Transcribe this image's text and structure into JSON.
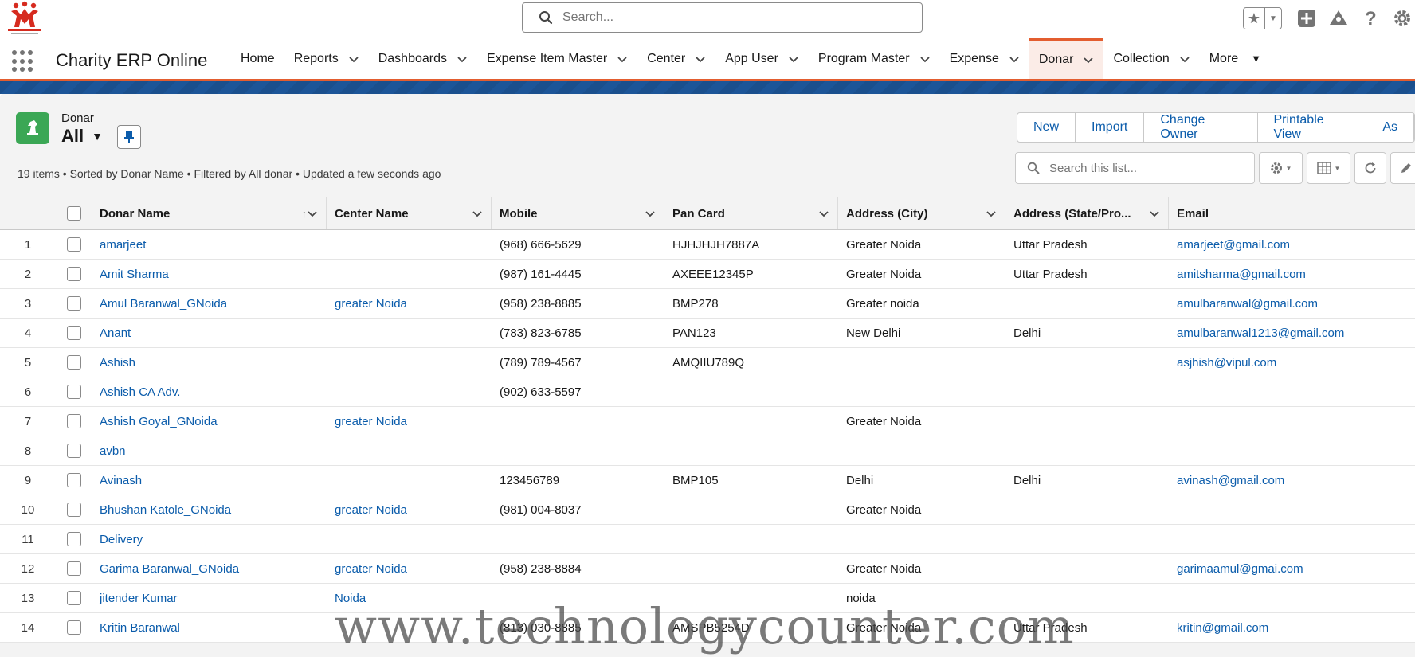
{
  "header": {
    "search_placeholder": "Search..."
  },
  "app": {
    "name": "Charity ERP Online"
  },
  "nav": [
    {
      "label": "Home",
      "has_menu": false
    },
    {
      "label": "Reports",
      "has_menu": true
    },
    {
      "label": "Dashboards",
      "has_menu": true
    },
    {
      "label": "Expense Item Master",
      "has_menu": true
    },
    {
      "label": "Center",
      "has_menu": true
    },
    {
      "label": "App User",
      "has_menu": true
    },
    {
      "label": "Program Master",
      "has_menu": true
    },
    {
      "label": "Expense",
      "has_menu": true
    },
    {
      "label": "Donar",
      "has_menu": true,
      "active": true
    },
    {
      "label": "Collection",
      "has_menu": true
    },
    {
      "label": "More",
      "has_menu": true,
      "more": true
    }
  ],
  "list": {
    "object_label": "Donar",
    "view_name": "All",
    "info": "19 items • Sorted by Donar Name • Filtered by All donar • Updated a few seconds ago",
    "actions": [
      "New",
      "Import",
      "Change Owner",
      "Printable View",
      "As"
    ],
    "search_placeholder": "Search this list..."
  },
  "table": {
    "columns": [
      "Donar Name",
      "Center Name",
      "Mobile",
      "Pan Card",
      "Address (City)",
      "Address (State/Pro...",
      "Email"
    ],
    "rows": [
      {
        "n": "1",
        "name": "amarjeet",
        "center": "",
        "mobile": "(968) 666-5629",
        "pan": "HJHJHJH7887A",
        "city": "Greater Noida",
        "state": "Uttar Pradesh",
        "email": "amarjeet@gmail.com"
      },
      {
        "n": "2",
        "name": "Amit Sharma",
        "center": "",
        "mobile": "(987) 161-4445",
        "pan": "AXEEE12345P",
        "city": "Greater Noida",
        "state": "Uttar Pradesh",
        "email": "amitsharma@gmail.com"
      },
      {
        "n": "3",
        "name": "Amul Baranwal_GNoida",
        "center": "greater Noida",
        "mobile": "(958) 238-8885",
        "pan": "BMP278",
        "city": "Greater noida",
        "state": "",
        "email": "amulbaranwal@gmail.com"
      },
      {
        "n": "4",
        "name": "Anant",
        "center": "",
        "mobile": "(783) 823-6785",
        "pan": "PAN123",
        "city": "New Delhi",
        "state": "Delhi",
        "email": "amulbaranwal1213@gmail.com"
      },
      {
        "n": "5",
        "name": "Ashish",
        "center": "",
        "mobile": "(789) 789-4567",
        "pan": "AMQIIU789Q",
        "city": "",
        "state": "",
        "email": "asjhish@vipul.com"
      },
      {
        "n": "6",
        "name": "Ashish CA Adv.",
        "center": "",
        "mobile": "(902) 633-5597",
        "pan": "",
        "city": "",
        "state": "",
        "email": ""
      },
      {
        "n": "7",
        "name": "Ashish Goyal_GNoida",
        "center": "greater Noida",
        "mobile": "",
        "pan": "",
        "city": "Greater Noida",
        "state": "",
        "email": ""
      },
      {
        "n": "8",
        "name": "avbn",
        "center": "",
        "mobile": "",
        "pan": "",
        "city": "",
        "state": "",
        "email": ""
      },
      {
        "n": "9",
        "name": "Avinash",
        "center": "",
        "mobile": "123456789",
        "pan": "BMP105",
        "city": "Delhi",
        "state": "Delhi",
        "email": "avinash@gmail.com"
      },
      {
        "n": "10",
        "name": "Bhushan Katole_GNoida",
        "center": "greater Noida",
        "mobile": "(981) 004-8037",
        "pan": "",
        "city": "Greater Noida",
        "state": "",
        "email": ""
      },
      {
        "n": "11",
        "name": "Delivery",
        "center": "",
        "mobile": "",
        "pan": "",
        "city": "",
        "state": "",
        "email": ""
      },
      {
        "n": "12",
        "name": "Garima Baranwal_GNoida",
        "center": "greater Noida",
        "mobile": "(958) 238-8884",
        "pan": "",
        "city": "Greater Noida",
        "state": "",
        "email": "garimaamul@gmai.com"
      },
      {
        "n": "13",
        "name": "jitender Kumar",
        "center": "Noida",
        "mobile": "",
        "pan": "",
        "city": "noida",
        "state": "",
        "email": ""
      },
      {
        "n": "14",
        "name": "Kritin Baranwal",
        "center": "",
        "mobile": "(813) 030-8885",
        "pan": "AMSPB5254D",
        "city": "Greater Noida",
        "state": "Uttar Pradesh",
        "email": "kritin@gmail.com"
      }
    ]
  },
  "watermark": "www.technologycounter.com",
  "colors": {
    "accent": "#e35d2f",
    "link": "#0b5cab",
    "object_icon": "#3ba755",
    "band": "#1a4f8d"
  }
}
